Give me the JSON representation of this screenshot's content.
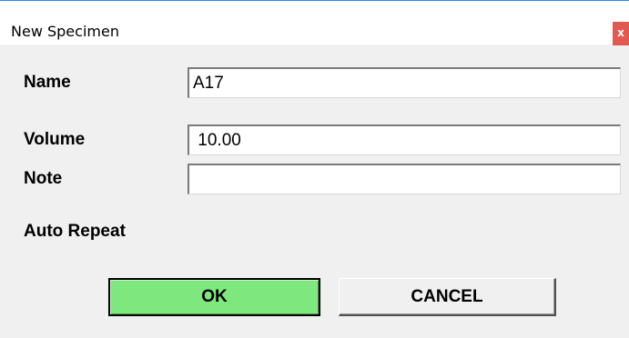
{
  "window": {
    "title": "New Specimen",
    "close_glyph": "x"
  },
  "form": {
    "name_label": "Name",
    "name_value": "A17",
    "volume_label": "Volume",
    "volume_value": " 10.00",
    "note_label": "Note",
    "note_value": "",
    "auto_repeat_label": "Auto Repeat"
  },
  "buttons": {
    "ok_label": "OK",
    "cancel_label": "CANCEL"
  },
  "colors": {
    "ok_button_bg": "#7ee87e",
    "close_button_bg": "#e05a52",
    "dialog_bg": "#f0f0f0",
    "title_accent": "#2e8ae6"
  }
}
